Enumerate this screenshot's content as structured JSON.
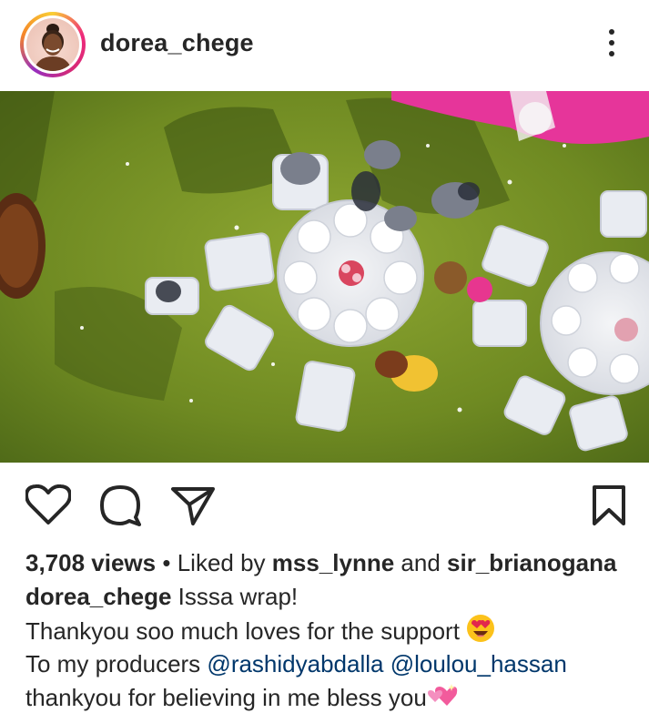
{
  "post": {
    "username": "dorea_chege",
    "media_alt": "aerial view of outdoor dining setup on grass"
  },
  "icons": {
    "avatar": "profile-photo",
    "more": "more-options-icon",
    "like": "heart-icon",
    "comment": "comment-icon",
    "share": "send-icon",
    "save": "bookmark-icon"
  },
  "stats": {
    "views": "3,708 views",
    "separator": "•",
    "liked_by_prefix": "Liked by",
    "liker_1": "mss_lynne",
    "and": "and",
    "liker_2": "sir_brianogana"
  },
  "caption": {
    "username": "dorea_chege",
    "line1": "Isssa wrap!",
    "line2": "Thankyou soo much loves for the support",
    "line3_prefix": "To my producers",
    "mention_1": "@rashidyabdalla",
    "mention_2": "@loulou_hassan",
    "line4": "thankyou for believing in me bless you"
  },
  "colors": {
    "text": "#262626",
    "mention": "#00376b",
    "grass": "#6c8a1f"
  }
}
